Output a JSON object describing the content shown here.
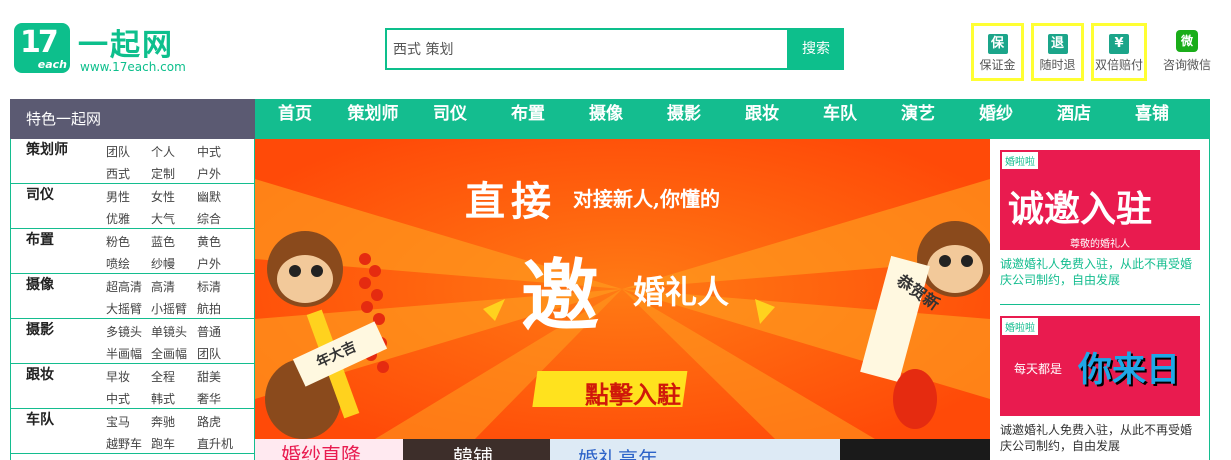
{
  "header": {
    "logo_mark": "17",
    "logo_mark_sub": "each",
    "logo_text": "一起网",
    "logo_url": "www.17each.com",
    "search_placeholder": "西式 策划",
    "search_button": "搜索",
    "badges": [
      {
        "icon": "保",
        "label": "保证金"
      },
      {
        "icon": "退",
        "label": "随时退"
      },
      {
        "icon": "¥",
        "label": "双倍赔付"
      }
    ],
    "wechat": {
      "icon": "微",
      "label": "咨询微信"
    }
  },
  "nav": {
    "label": "特色一起网",
    "items": [
      "首页",
      "策划师",
      "司仪",
      "布置",
      "摄像",
      "摄影",
      "跟妆",
      "车队",
      "演艺",
      "婚纱",
      "酒店",
      "喜铺"
    ]
  },
  "sidebar": [
    {
      "name": "策划师",
      "tags": [
        "团队",
        "个人",
        "中式",
        "西式",
        "定制",
        "户外"
      ]
    },
    {
      "name": "司仪",
      "tags": [
        "男性",
        "女性",
        "幽默",
        "优雅",
        "大气",
        "综合"
      ]
    },
    {
      "name": "布置",
      "tags": [
        "粉色",
        "蓝色",
        "黄色",
        "喷绘",
        "纱幔",
        "户外"
      ]
    },
    {
      "name": "摄像",
      "tags": [
        "超高清",
        "高清",
        "标清",
        "大摇臂",
        "小摇臂",
        "航拍"
      ]
    },
    {
      "name": "摄影",
      "tags": [
        "多镜头",
        "单镜头",
        "普通",
        "半画幅",
        "全画幅",
        "团队"
      ]
    },
    {
      "name": "跟妆",
      "tags": [
        "早妆",
        "全程",
        "甜美",
        "中式",
        "韩式",
        "奢华"
      ]
    },
    {
      "name": "车队",
      "tags": [
        "宝马",
        "奔驰",
        "路虎",
        "越野车",
        "跑车",
        "直升机"
      ]
    }
  ],
  "banner": {
    "headline": "直接",
    "headline_sub": "对接新人,你懂的",
    "main_char": "邀",
    "main_sub": "婚礼人",
    "cta": "點擊入駐",
    "scroll_left": "年大吉",
    "scroll_right": "恭贺新"
  },
  "right_ads": [
    {
      "brand": "婚啦啦",
      "title": "诚邀入驻",
      "sub": "尊敬的婚礼人",
      "desc": "诚邀婚礼人免费入驻，从此不再受婚庆公司制约，自由发展"
    },
    {
      "brand": "婚啦啦",
      "title": "你来日",
      "sub": "每天都是",
      "desc": "诚邀婚礼人免费入驻，从此不再受婚庆公司制约，自由发展"
    }
  ],
  "bottom_strip": [
    "婚纱直降",
    "韓铺",
    "婚礼高年"
  ],
  "colors": {
    "brand": "#14bd8f",
    "nav_label": "#5b5a72",
    "banner": "#ff5a0a",
    "highlight": "#ffff33",
    "ad": "#e91b4f"
  }
}
